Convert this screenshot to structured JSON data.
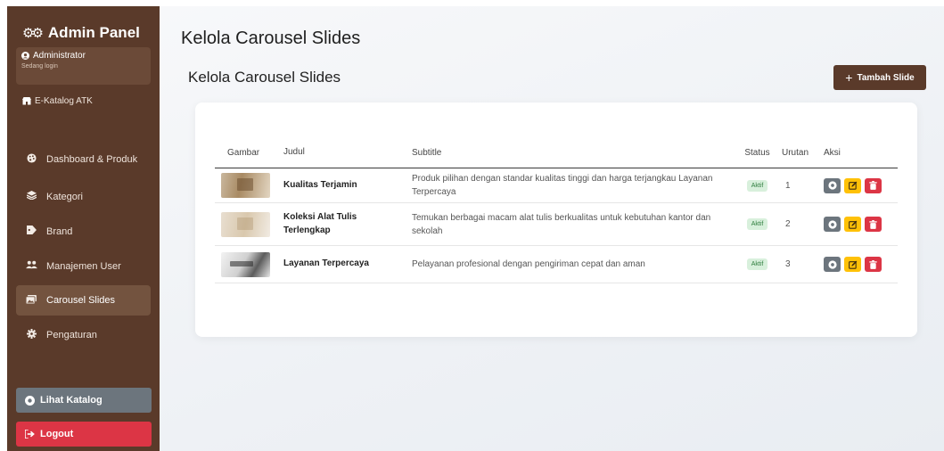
{
  "sidebar": {
    "brand": "Admin Panel",
    "user": {
      "name": "Administrator",
      "status": "Sedang login"
    },
    "catalog_link": "E-Katalog ATK",
    "items": [
      {
        "label": "Dashboard & Produk",
        "icon": "palette-icon"
      },
      {
        "label": "Kategori",
        "icon": "layers-icon"
      },
      {
        "label": "Brand",
        "icon": "tag-icon"
      },
      {
        "label": "Manajemen User",
        "icon": "users-icon"
      },
      {
        "label": "Carousel Slides",
        "icon": "images-icon",
        "active": true
      },
      {
        "label": "Pengaturan",
        "icon": "gear-icon"
      }
    ],
    "view_catalog": "Lihat Katalog",
    "logout": "Logout"
  },
  "main": {
    "page_title": "Kelola Carousel Slides",
    "section_title": "Kelola Carousel Slides",
    "add_button": "Tambah Slide"
  },
  "table": {
    "headers": [
      "Gambar",
      "Judul",
      "Subtitle",
      "Status",
      "Urutan",
      "Aksi"
    ],
    "rows": [
      {
        "title": "Kualitas Terjamin",
        "subtitle": "Produk pilihan dengan standar kualitas tinggi dan harga terjangkau Layanan Terpercaya",
        "status": "Aktif",
        "order": "1"
      },
      {
        "title": "Koleksi Alat Tulis Terlengkap",
        "subtitle": "Temukan berbagai macam alat tulis berkualitas untuk kebutuhan kantor dan sekolah",
        "status": "Aktif",
        "order": "2"
      },
      {
        "title": "Layanan Terpercaya",
        "subtitle": "Pelayanan profesional dengan pengiriman cepat dan aman",
        "status": "Aktif",
        "order": "3"
      }
    ]
  },
  "colors": {
    "sidebar_bg": "#5a3a2a",
    "primary": "#5a3a2a",
    "secondary": "#6c757d",
    "warning": "#ffc107",
    "danger": "#dc3545",
    "success_bg": "#d8f0dc"
  }
}
